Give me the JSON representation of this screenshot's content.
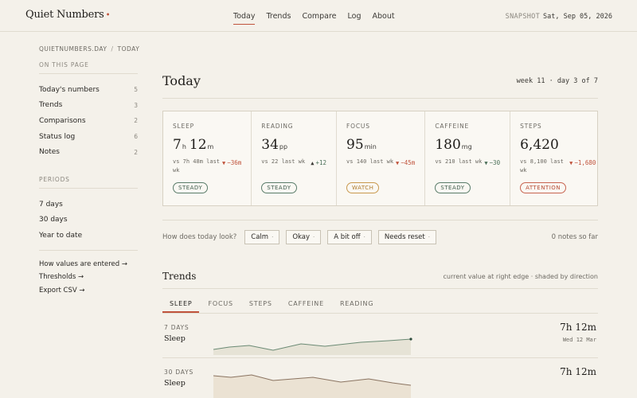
{
  "header": {
    "brand": "Quiet Numbers",
    "brand_dot": "•",
    "nav": [
      {
        "label": "Today",
        "active": true
      },
      {
        "label": "Trends",
        "active": false
      },
      {
        "label": "Compare",
        "active": false
      },
      {
        "label": "Log",
        "active": false
      },
      {
        "label": "About",
        "active": false
      }
    ],
    "snapshot_label": "SNAPSHOT",
    "snapshot_date": "Sat, Sep 05, 2026"
  },
  "sidebar": {
    "breadcrumb": [
      "QUIETNUMBERS.DAY",
      "TODAY"
    ],
    "breadcrumb_sep": "/",
    "on_this_page_heading": "ON THIS PAGE",
    "on_this_page": [
      {
        "label": "Today's numbers",
        "count": "5"
      },
      {
        "label": "Trends",
        "count": "3"
      },
      {
        "label": "Comparisons",
        "count": "2"
      },
      {
        "label": "Status log",
        "count": "6"
      },
      {
        "label": "Notes",
        "count": "2"
      }
    ],
    "periods_heading": "PERIODS",
    "periods": [
      "7 days",
      "30 days",
      "Year to date"
    ],
    "links": [
      "How values are entered →",
      "Thresholds →",
      "Export CSV →"
    ]
  },
  "main": {
    "title": "Today",
    "week_info": "week 11 · day 3 of 7",
    "cards": [
      {
        "label": "SLEEP",
        "value_parts": [
          {
            "n": "7",
            "u": "h"
          },
          {
            "n": "12",
            "u": "m"
          }
        ],
        "vs": "vs 7h 48m last wk",
        "delta": "−36m",
        "direction": "down",
        "status": "STEADY",
        "status_kind": "steady"
      },
      {
        "label": "READING",
        "value_parts": [
          {
            "n": "34",
            "u": "pp"
          }
        ],
        "vs": "vs 22 last wk",
        "delta": "+12",
        "direction": "up",
        "status": "STEADY",
        "status_kind": "steady"
      },
      {
        "label": "FOCUS",
        "value_parts": [
          {
            "n": "95",
            "u": "min"
          }
        ],
        "vs": "vs 140 last wk",
        "delta": "−45m",
        "direction": "down",
        "status": "WATCH",
        "status_kind": "watch"
      },
      {
        "label": "CAFFEINE",
        "value_parts": [
          {
            "n": "180",
            "u": "mg"
          }
        ],
        "vs": "vs 210 last wk",
        "delta": "−30",
        "direction": "down-good",
        "status": "STEADY",
        "status_kind": "steady"
      },
      {
        "label": "STEPS",
        "value_parts": [
          {
            "n": "6,420",
            "u": ""
          }
        ],
        "vs": "vs 8,100 last wk",
        "delta": "−1,680",
        "direction": "down",
        "status": "ATTENTION",
        "status_kind": "attention"
      }
    ],
    "mood_question": "How does today look?",
    "mood_options": [
      "Calm",
      "Okay",
      "A bit off",
      "Needs reset"
    ],
    "mood_dot": "·",
    "notes_count": "0 notes so far",
    "trends_title": "Trends",
    "trends_note": "current value at right edge · shaded by direction",
    "trend_tabs": [
      {
        "label": "SLEEP",
        "active": true
      },
      {
        "label": "FOCUS",
        "active": false
      },
      {
        "label": "STEPS",
        "active": false
      },
      {
        "label": "CAFFEINE",
        "active": false
      },
      {
        "label": "READING",
        "active": false
      }
    ],
    "trend_rows": [
      {
        "period": "7 DAYS",
        "name": "Sleep",
        "value": "7h 12m",
        "date": "Wed 12 Mar",
        "color": "#6b8a74",
        "fill": "#e6e3d6"
      },
      {
        "period": "30 DAYS",
        "name": "Sleep",
        "value": "7h 12m",
        "date": "",
        "color": "#8a7360",
        "fill": "#ebe2d3"
      }
    ]
  },
  "colors": {
    "accent": "#c0533c",
    "steady": "#5a7c6a",
    "watch": "#c9994e",
    "attention": "#c86450",
    "background": "#f4f1ea"
  }
}
